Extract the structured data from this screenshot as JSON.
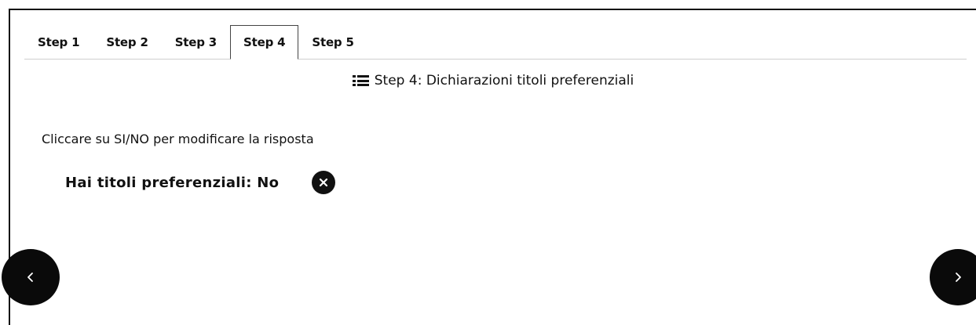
{
  "tabs": [
    {
      "label": "Step 1",
      "active": false
    },
    {
      "label": "Step 2",
      "active": false
    },
    {
      "label": "Step 3",
      "active": false
    },
    {
      "label": "Step 4",
      "active": true
    },
    {
      "label": "Step 5",
      "active": false
    }
  ],
  "step_header": {
    "icon": "list-icon",
    "title": "Step 4: Dichiarazioni titoli preferenziali"
  },
  "instructions": "Cliccare su SI/NO per modificare la risposta",
  "question": {
    "label": "Hai titoli preferenziali: No",
    "answer_icon": "close-circle-icon"
  },
  "navigation": {
    "prev_icon": "chevron-left-icon",
    "next_icon": "chevron-right-icon"
  },
  "colors": {
    "button_bg": "#0a0a0a",
    "text": "#111111",
    "tab_border": "#444444"
  }
}
